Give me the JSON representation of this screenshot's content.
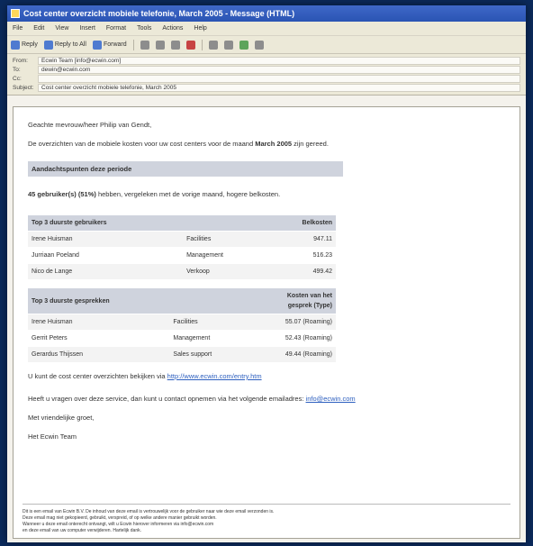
{
  "window": {
    "title": "Cost center overzicht mobiele telefonie, March 2005 - Message (HTML)"
  },
  "menu": [
    "File",
    "Edit",
    "View",
    "Insert",
    "Format",
    "Tools",
    "Actions",
    "Help"
  ],
  "toolbar": {
    "reply": "Reply",
    "reply_all": "Reply to All",
    "forward": "Forward"
  },
  "headers": {
    "from_label": "From:",
    "from": "Ecwin Team [info@ecwin.com]",
    "to_label": "To:",
    "to": "dewin@ecwin.com",
    "cc_label": "Cc:",
    "cc": "",
    "subject_label": "Subject:",
    "subject": "Cost center overzicht mobiele telefonie, March 2005"
  },
  "email": {
    "greeting": "Geachte mevrouw/heer Philip van Gendt,",
    "intro_pre": "De overzichten van de mobiele kosten voor uw cost centers voor de maand ",
    "intro_month": "March 2005",
    "intro_post": " zijn gereed.",
    "attention_title": "Aandachtspunten deze periode",
    "attention_bold": "45 gebruiker(s) (51%)",
    "attention_rest": " hebben, vergeleken met de vorige maand, hogere belkosten.",
    "table1": {
      "title": "Top 3 duurste gebruikers",
      "cost_header": "Belkosten",
      "rows": [
        {
          "name": "Irene Huisman",
          "dept": "Facilities",
          "cost": "947.11"
        },
        {
          "name": "Jurriaan Poeland",
          "dept": "Management",
          "cost": "516.23"
        },
        {
          "name": "Nico de Lange",
          "dept": "Verkoop",
          "cost": "499.42"
        }
      ]
    },
    "table2": {
      "title": "Top 3 duurste gesprekken",
      "cost_header_1": "Kosten van het",
      "cost_header_2": "gesprek (Type)",
      "rows": [
        {
          "name": "Irene Huisman",
          "dept": "Facilities",
          "cost": "55.07 (Roaming)"
        },
        {
          "name": "Gerrit Peters",
          "dept": "Management",
          "cost": "52.43 (Roaming)"
        },
        {
          "name": "Gerardus Thijssen",
          "dept": "Sales support",
          "cost": "49.44 (Roaming)"
        }
      ]
    },
    "link_text": "U kunt de cost center overzichten bekijken via ",
    "link_url": "http://www.ecwin.com/entry.htm",
    "contact_text": "Heeft u vragen over deze service, dan kunt u contact opnemen via het volgende emailadres: ",
    "contact_email": "info@ecwin.com",
    "closing": "Met vriendelijke groet,",
    "signature": "Het Ecwin Team",
    "footer_1": "Dit is een email van Ecwin B.V. De inhoud van deze email is vertrouwelijk voor de gebruiker naar wie deze email verzonden is.",
    "footer_2": "Deze email mag niet gekopieerd, gebruikt, verspreid, of op welke andere manier gebruikt worden.",
    "footer_3": "Wanneer u deze email onterecht ontvangt, wilt u Ecwin hierover informeren via info@ecwin.com",
    "footer_4": "en deze email van uw computer verwijderen. Hartelijk dank."
  }
}
